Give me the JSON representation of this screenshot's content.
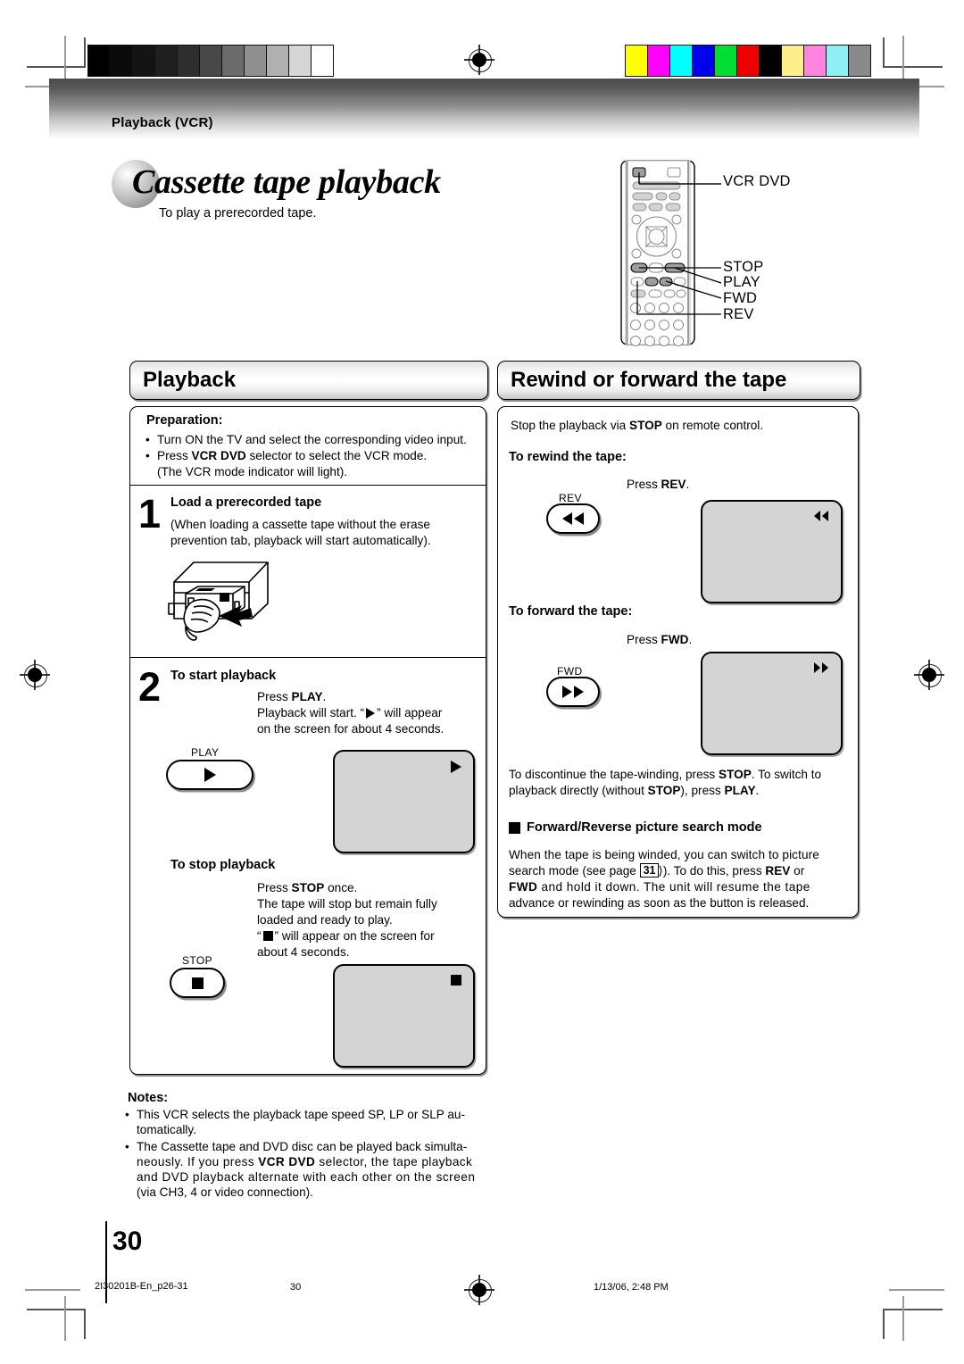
{
  "print_marks": {
    "grayscale_swatches": [
      "#000000",
      "#0a0a0a",
      "#141414",
      "#1f1f1f",
      "#2e2e2e",
      "#474747",
      "#6b6b6b",
      "#8f8f8f",
      "#b0b0b0",
      "#d6d6d6",
      "#ffffff"
    ],
    "color_swatches": [
      "#ffff00",
      "#ff00ff",
      "#00ffff",
      "#0000ee",
      "#00dd33",
      "#ee0000",
      "#000000",
      "#ffef8a",
      "#ff84e0",
      "#8ef0f5",
      "#8a8a8a"
    ]
  },
  "header": {
    "running_title": "Playback (VCR)"
  },
  "page_title": {
    "heading": "Cassette tape playback",
    "subtitle": "To play a prerecorded tape."
  },
  "remote": {
    "labels": [
      "VCR DVD",
      "STOP",
      "PLAY",
      "FWD",
      "REV"
    ]
  },
  "left_column": {
    "section_title": "Playback",
    "preparation": {
      "heading": "Preparation:",
      "items": [
        "Turn ON the TV and select the corresponding video input.",
        "Press VCR DVD selector to select the VCR mode."
      ],
      "item2_bold": "VCR DVD",
      "item2_pre": "Press ",
      "item2_post": " selector to select the VCR mode.",
      "item2_line2": "(The VCR mode indicator will light)."
    },
    "step1": {
      "number": "1",
      "heading": "Load a prerecorded tape",
      "body_line1": "(When loading a cassette tape without the erase",
      "body_line2": "prevention tab, playback will start automatically)."
    },
    "step2": {
      "number": "2",
      "heading": "To start playback",
      "press_pre": "Press ",
      "press_key": "PLAY",
      "press_post": ".",
      "line2_a": "Playback will start. “",
      "line2_b": "” will appear",
      "line3": "on the screen for about 4 seconds.",
      "button_caption": "PLAY",
      "button_icon": "play-triangle-icon",
      "screen_icon": "play-triangle-icon"
    },
    "stop_playback": {
      "heading": "To stop playback",
      "press_pre": "Press ",
      "press_key": "STOP",
      "press_post": " once.",
      "line2": "The tape will stop but remain fully",
      "line3": "loaded and ready to play.",
      "line4_a": "“",
      "line4_b": "” will appear on the screen for",
      "line5": "about 4 seconds.",
      "button_caption": "STOP",
      "button_icon": "stop-square-icon",
      "screen_icon": "stop-square-icon"
    },
    "vcr_illustration": "hand-loading-cassette-into-vcr-illustration"
  },
  "notes": {
    "heading": "Notes:",
    "items": [
      {
        "lines": [
          "This VCR selects the playback tape speed SP, LP or SLP au-",
          "tomatically."
        ]
      },
      {
        "lines": [
          "The Cassette tape and DVD disc can be played back simulta-",
          "neously. If you press VCR DVD selector, the tape playback",
          "and DVD playback alternate with each other on the screen",
          "(via CH3, 4 or video connection)."
        ]
      }
    ]
  },
  "right_column": {
    "section_title": "Rewind or forward the tape",
    "intro_pre": "Stop the playback via ",
    "intro_key": "STOP",
    "intro_post": " on remote control.",
    "rewind": {
      "heading": "To rewind the tape:",
      "press_pre": "Press ",
      "press_key": "REV",
      "press_post": ".",
      "button_caption": "REV",
      "button_icon": "rewind-double-triangle-icon",
      "screen_icon": "rewind-double-triangle-icon"
    },
    "forward": {
      "heading": "To forward the tape:",
      "press_pre": "Press ",
      "press_key": "FWD",
      "press_post": ".",
      "button_caption": "FWD",
      "button_icon": "fast-forward-double-triangle-icon",
      "screen_icon": "fast-forward-double-triangle-icon"
    },
    "discontinue": {
      "line1_a": "To discontinue the tape-winding, press ",
      "line1_key": "STOP",
      "line1_b": ". To switch to",
      "line2_a": "playback directly (without ",
      "line2_key": "STOP",
      "line2_b": "), press ",
      "line2_key2": "PLAY",
      "line2_c": "."
    },
    "search_mode": {
      "heading": "Forward/Reverse picture search mode",
      "line1": "When the tape is being winded, you can switch to picture",
      "line2_a": "search mode (see page ",
      "page_ref": "31",
      "line2_b": "). To do this, press ",
      "line2_key1": "REV",
      "line2_c": " or",
      "line3_key": "FWD",
      "line3_a": " and hold it down. The unit will resume the tape",
      "line4": "advance or rewinding as soon as the button is released."
    }
  },
  "footer": {
    "page_number": "30",
    "file_name": "2I30201B-En_p26-31",
    "folio": "30",
    "timestamp": "1/13/06, 2:48 PM"
  }
}
